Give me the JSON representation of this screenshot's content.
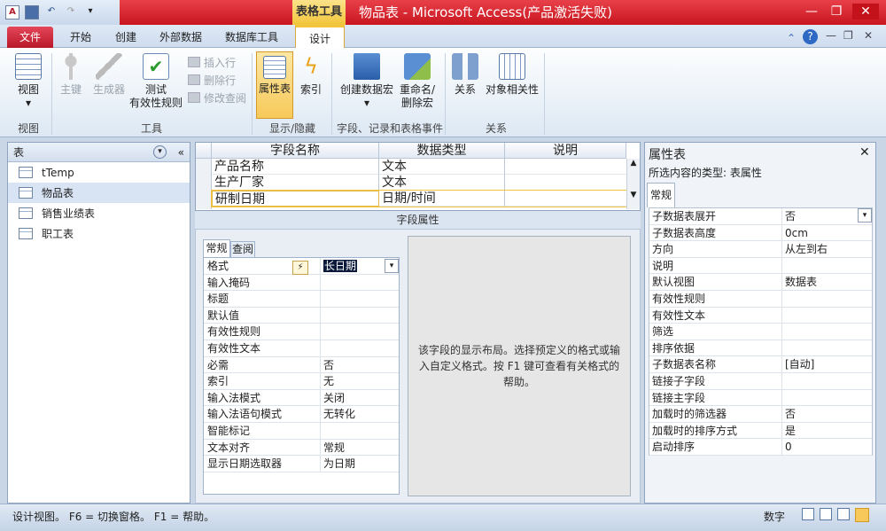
{
  "window": {
    "title": "物品表 - Microsoft Access(产品激活失败)",
    "context_tab": "表格工具",
    "app_icon": "A"
  },
  "tabs": [
    "文件",
    "开始",
    "创建",
    "外部数据",
    "数据库工具",
    "设计"
  ],
  "ribbon": {
    "view": {
      "label": "视图",
      "group": "视图"
    },
    "tools": {
      "group": "工具",
      "primary_key": "主键",
      "builder": "生成器",
      "test": "测试",
      "test2": "有效性规则",
      "insert_row": "插入行",
      "delete_row": "删除行",
      "modify_lookup": "修改查阅"
    },
    "showhide": {
      "group": "显示/隐藏",
      "property_sheet": "属性表",
      "indexes": "索引"
    },
    "field_events": {
      "group": "字段、记录和表格事件",
      "create_macro": "创建数据宏",
      "rename_macro": "重命名/",
      "rename_macro2": "删除宏"
    },
    "relations": {
      "group": "关系",
      "relationships": "关系",
      "dependencies": "对象相关性"
    }
  },
  "nav": {
    "title": "表",
    "items": [
      "tTemp",
      "物品表",
      "销售业绩表",
      "职工表"
    ]
  },
  "grid": {
    "headers": [
      "字段名称",
      "数据类型",
      "说明"
    ],
    "rows": [
      {
        "name": "产品名称",
        "type": "文本"
      },
      {
        "name": "生产厂家",
        "type": "文本"
      },
      {
        "name": "研制日期",
        "type": "日期/时间"
      }
    ]
  },
  "field_props": {
    "bar": "字段属性",
    "tab_general": "常规",
    "tab_lookup": "查阅",
    "rows": [
      {
        "k": "格式",
        "v": "长日期"
      },
      {
        "k": "输入掩码",
        "v": ""
      },
      {
        "k": "标题",
        "v": ""
      },
      {
        "k": "默认值",
        "v": ""
      },
      {
        "k": "有效性规则",
        "v": ""
      },
      {
        "k": "有效性文本",
        "v": ""
      },
      {
        "k": "必需",
        "v": "否"
      },
      {
        "k": "索引",
        "v": "无"
      },
      {
        "k": "输入法模式",
        "v": "关闭"
      },
      {
        "k": "输入法语句模式",
        "v": "无转化"
      },
      {
        "k": "智能标记",
        "v": ""
      },
      {
        "k": "文本对齐",
        "v": "常规"
      },
      {
        "k": "显示日期选取器",
        "v": "为日期"
      }
    ],
    "help": "该字段的显示布局。选择预定义的格式或输入自定义格式。按 F1 键可查看有关格式的帮助。"
  },
  "property_sheet": {
    "title": "属性表",
    "selection_type": "所选内容的类型: 表属性",
    "tab": "常规",
    "rows": [
      {
        "k": "子数据表展开",
        "v": "否"
      },
      {
        "k": "子数据表高度",
        "v": "0cm"
      },
      {
        "k": "方向",
        "v": "从左到右"
      },
      {
        "k": "说明",
        "v": ""
      },
      {
        "k": "默认视图",
        "v": "数据表"
      },
      {
        "k": "有效性规则",
        "v": ""
      },
      {
        "k": "有效性文本",
        "v": ""
      },
      {
        "k": "筛选",
        "v": ""
      },
      {
        "k": "排序依据",
        "v": ""
      },
      {
        "k": "子数据表名称",
        "v": "[自动]"
      },
      {
        "k": "链接子字段",
        "v": ""
      },
      {
        "k": "链接主字段",
        "v": ""
      },
      {
        "k": "加载时的筛选器",
        "v": "否"
      },
      {
        "k": "加载时的排序方式",
        "v": "是"
      },
      {
        "k": "启动排序",
        "v": "0"
      }
    ]
  },
  "status": {
    "text": "设计视图。  F6 = 切换窗格。  F1 = 帮助。",
    "mode": "数字"
  }
}
